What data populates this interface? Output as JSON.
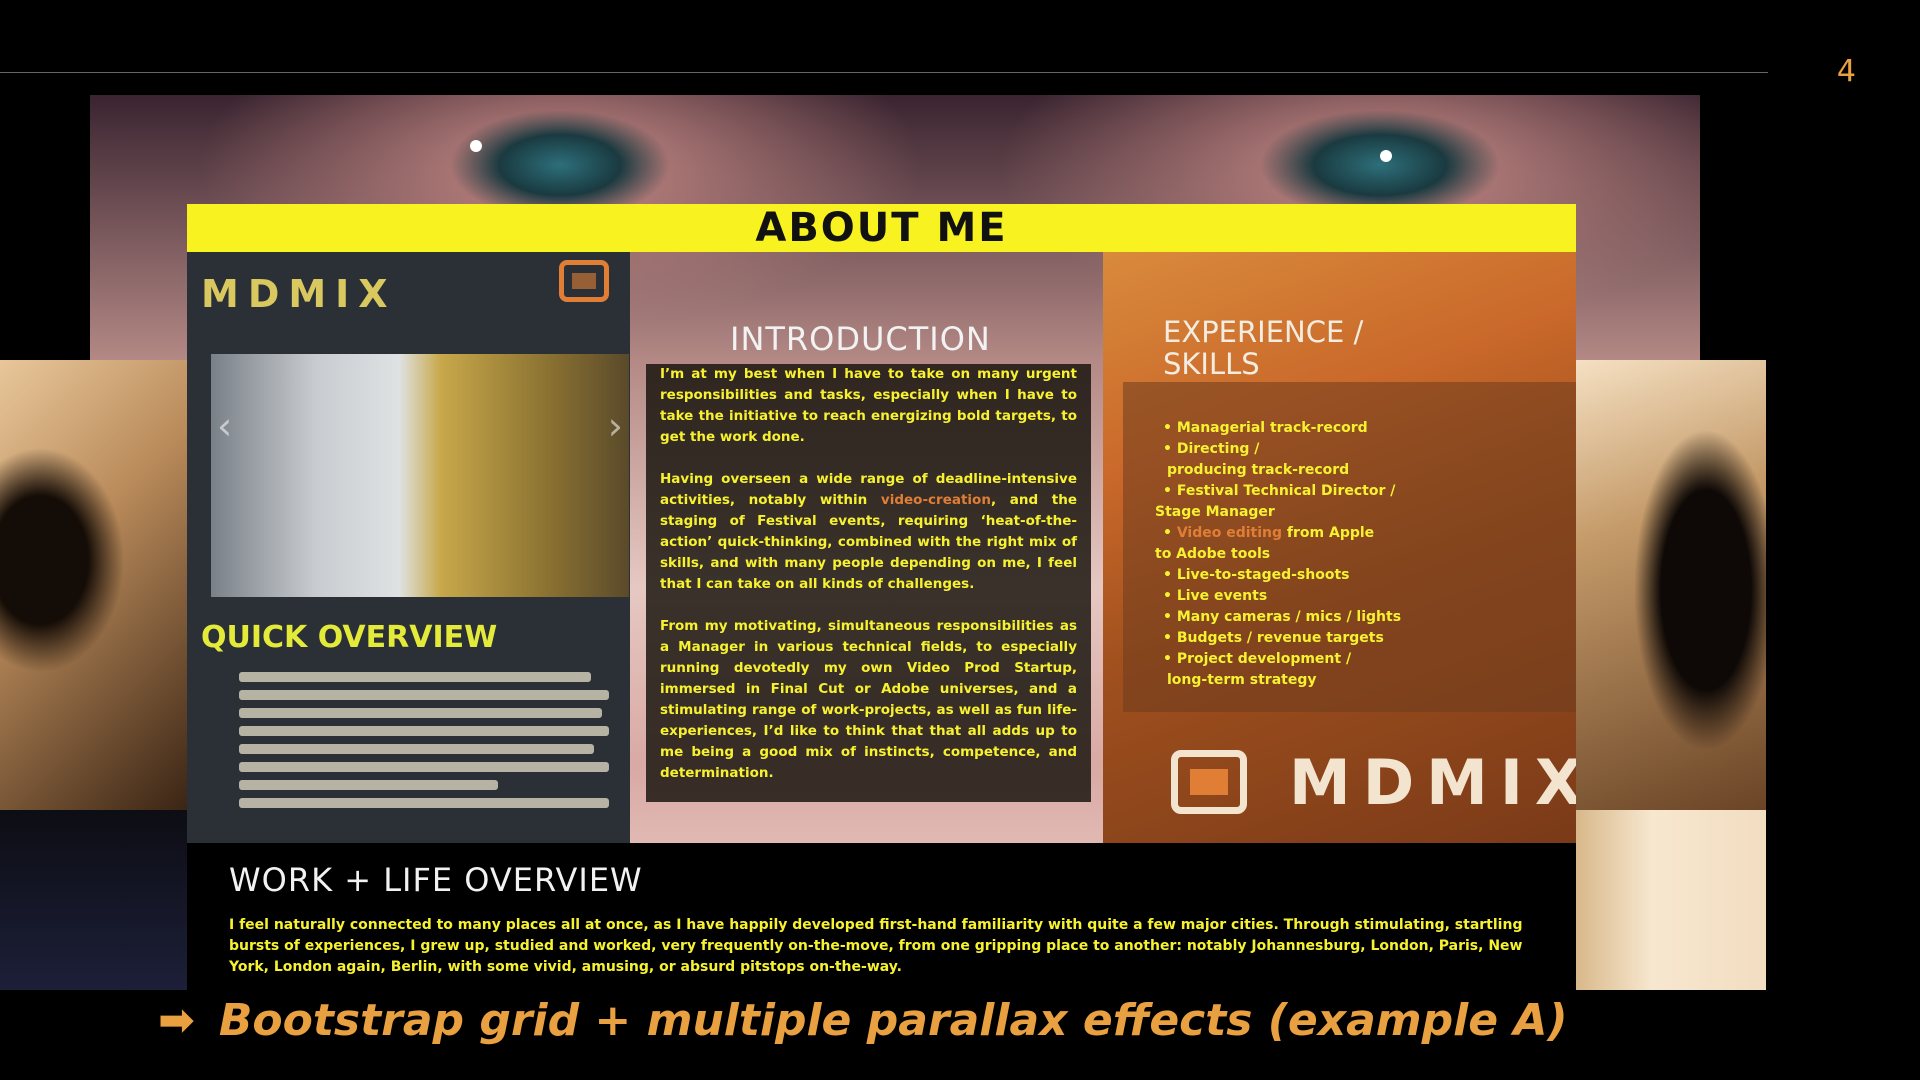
{
  "slide": {
    "number": "4",
    "caption_arrow": "➡",
    "caption": "Bootstrap grid + multiple parallax effects (example A)"
  },
  "website": {
    "about_title": "ABOUT ME",
    "logo": "MDMIX",
    "quick_overview_title": "QUICK OVERVIEW",
    "intro": {
      "title": "INTRODUCTION",
      "p1": "I’m at my best when I have to take on many urgent responsibilities and tasks, especially when I have to take the initiative to reach energizing bold targets, to get the work done.",
      "p2_before": "Having overseen a wide range of deadline-intensive activities, notably within ",
      "p2_accent": "video-creation",
      "p2_after": ", and the staging of Festival events, requiring ‘heat-of-the-action’ quick-thinking, combined with the right mix of skills, and with many people depending on me, I feel that I can take on all kinds of challenges.",
      "p3": "From my motivating, simultaneous responsibilities as a Manager in various technical fields, to especially running devotedly my own Video Prod Startup, immersed in Final Cut or Adobe universes, and a stimulating range of work-projects, as well as fun life-experiences, I’d like to think that that all adds up to me being a good mix of instincts, competence, and determination."
    },
    "experience": {
      "title_line1": "EXPERIENCE /",
      "title_line2": "SKILLS",
      "items": [
        "Managerial track-record",
        "Directing /",
        "producing track-record",
        "Festival Technical Director /",
        "Stage Manager",
        "Video editing",
        "from Apple",
        "to Adobe tools",
        "Live-to-staged-shoots",
        "Live events",
        "Many cameras / mics / lights",
        "Budgets / revenue targets",
        "Project development /",
        "long-term strategy"
      ]
    },
    "work_life": {
      "title": "WORK + LIFE OVERVIEW",
      "text": "I feel naturally connected to many places all at once, as I have happily developed first-hand familiarity with quite a few major cities. Through stimulating, startling bursts of experiences, I grew up, studied and worked, very frequently on-the-move, from one gripping place to another: notably Johannesburg, London, Paris, New York, London again, Berlin, with some vivid, amusing, or absurd pitstops on-the-way."
    },
    "colors": {
      "yellow": "#f7f220",
      "orange": "#e07e36",
      "caption_orange": "#e8a040"
    }
  }
}
